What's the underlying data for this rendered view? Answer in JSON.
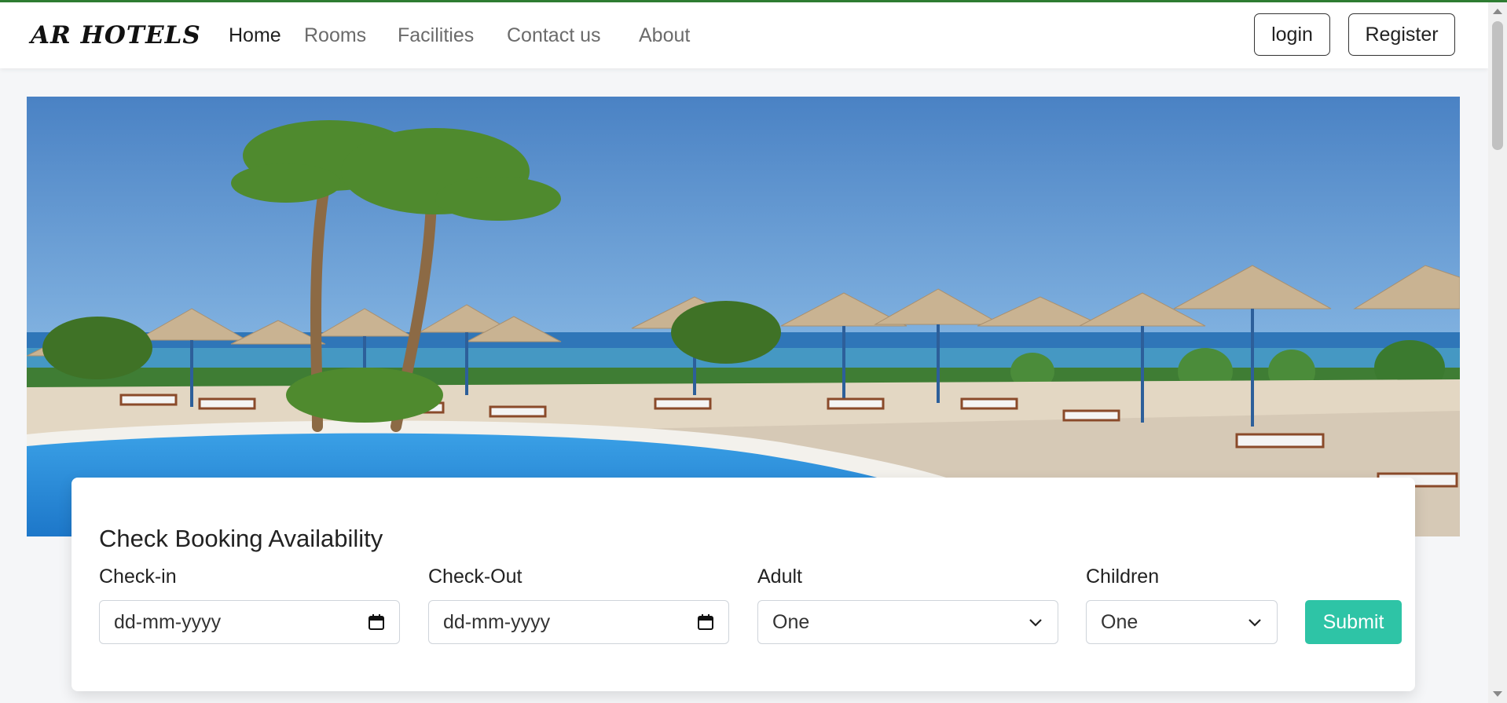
{
  "brand": "AR HOTELS",
  "nav": {
    "links": [
      "Home",
      "Rooms",
      "Facilities",
      "Contact us",
      "About"
    ],
    "active": "Home",
    "login_label": "login",
    "register_label": "Register"
  },
  "hero": {
    "image": "beach-resort-pool-photo"
  },
  "booking": {
    "title": "Check Booking Availability",
    "checkin_label": "Check-in",
    "checkin_placeholder": "dd-mm-yyyy",
    "checkout_label": "Check-Out",
    "checkout_placeholder": "dd-mm-yyyy",
    "adult_label": "Adult",
    "adult_value": "One",
    "children_label": "Children",
    "children_value": "One",
    "submit_label": "Submit"
  },
  "colors": {
    "accent": "#2ec4a6",
    "topline": "#2e7d32"
  }
}
